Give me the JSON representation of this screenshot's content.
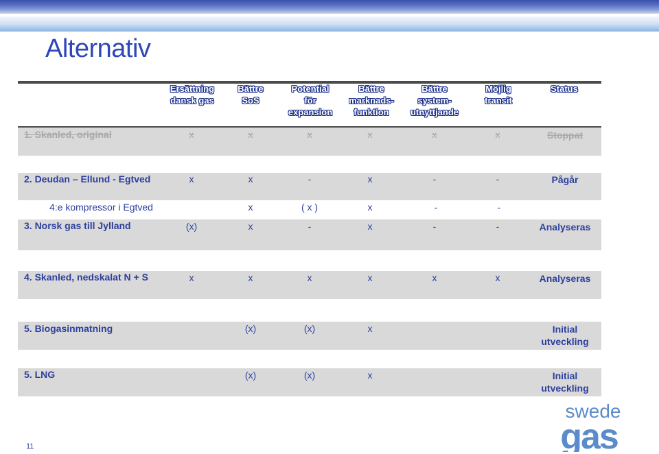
{
  "title": "Alternativ",
  "headers": [
    "Ersättning\ndansk gas",
    "Bättre\nSoS",
    "Potential\nför\nexpansion",
    "Bättre\nmarknads-\nfunktion",
    "Bättre\nsystem-\nutnyttjande",
    "Möjlig\ntransit",
    "Status"
  ],
  "rows": [
    {
      "name": "1. Skanled, original",
      "cells": [
        "x",
        "x",
        "x",
        "x",
        "x",
        "x"
      ],
      "status": "Stoppat"
    },
    {
      "name": "2. Deudan – Ellund - Egtved",
      "cells": [
        "x",
        "x",
        "-",
        "x",
        "-",
        "-"
      ],
      "status": "Pågår"
    },
    {
      "name": "4:e kompressor i Egtved",
      "cells": [
        "",
        "x",
        "( x )",
        "x",
        "-",
        "-"
      ],
      "status": ""
    },
    {
      "name": "3. Norsk gas till Jylland",
      "cells": [
        "(x)",
        "x",
        "-",
        "x",
        "-",
        "-"
      ],
      "status": "Analyseras"
    },
    {
      "name": "4. Skanled, nedskalat N + S",
      "cells": [
        "x",
        "x",
        "x",
        "x",
        "x",
        "x"
      ],
      "status": "Analyseras"
    },
    {
      "name": "5. Biogasinmatning",
      "cells": [
        "",
        "(x)",
        "(x)",
        "x",
        "",
        ""
      ],
      "status": "Initial\nutveckling"
    },
    {
      "name": "5. LNG",
      "cells": [
        "",
        "(x)",
        "(x)",
        "x",
        "",
        ""
      ],
      "status": "Initial\nutveckling"
    }
  ],
  "page_number": "11",
  "logo": {
    "line1": "swede",
    "line2": "gas"
  },
  "colors": {
    "text_blue": "#2d3f9e",
    "title_blue": "#2f46b8",
    "row_gray": "#d9d9d9",
    "struck_gray": "#a9a9a9",
    "logo_blue": "#5b8bc9"
  }
}
